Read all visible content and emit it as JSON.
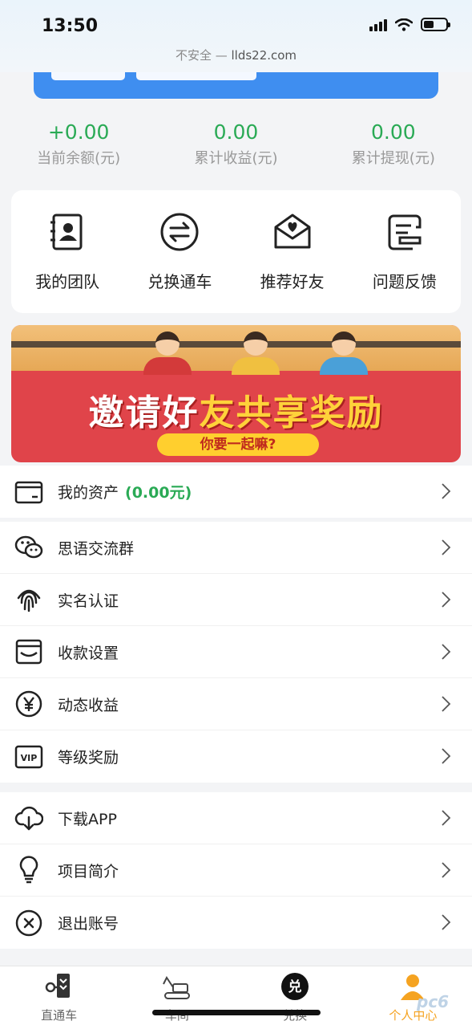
{
  "status": {
    "time": "13:50"
  },
  "browser": {
    "security": "不安全 — ",
    "domain": "llds22.com"
  },
  "stats": [
    {
      "value": "+0.00",
      "label": "当前余额(元)"
    },
    {
      "value": "0.00",
      "label": "累计收益(元)"
    },
    {
      "value": "0.00",
      "label": "累计提现(元)"
    }
  ],
  "quick_actions": [
    {
      "label": "我的团队",
      "icon": "contacts-icon"
    },
    {
      "label": "兑换通车",
      "icon": "exchange-icon"
    },
    {
      "label": "推荐好友",
      "icon": "heart-envelope-icon"
    },
    {
      "label": "问题反馈",
      "icon": "feedback-icon"
    }
  ],
  "promo": {
    "title_white": "邀请好",
    "title_yellow": "友共享奖励",
    "subtitle": "你要一起嘛?"
  },
  "menu_group1": [
    {
      "label": "我的资产",
      "extra": "(0.00元)",
      "icon": "wallet-icon"
    }
  ],
  "menu_group2": [
    {
      "label": "思语交流群",
      "icon": "wechat-icon"
    },
    {
      "label": "实名认证",
      "icon": "fingerprint-icon"
    },
    {
      "label": "收款设置",
      "icon": "inbox-icon"
    },
    {
      "label": "动态收益",
      "icon": "yen-icon"
    },
    {
      "label": "等级奖励",
      "icon": "vip-icon"
    }
  ],
  "menu_group3": [
    {
      "label": "下载APP",
      "icon": "cloud-download-icon"
    },
    {
      "label": "项目简介",
      "icon": "lightbulb-icon"
    },
    {
      "label": "退出账号",
      "icon": "close-circle-icon"
    }
  ],
  "tabs": [
    {
      "label": "直通车",
      "icon": "direct-train-icon",
      "active": false
    },
    {
      "label": "车间",
      "icon": "excavator-icon",
      "active": false
    },
    {
      "label": "兑换",
      "icon": "exchange-badge-icon",
      "active": false
    },
    {
      "label": "个人中心",
      "icon": "user-icon",
      "active": true
    }
  ],
  "colors": {
    "accent_green": "#2aaa55",
    "tab_active": "#f5a321",
    "promo_red": "#e0444a",
    "top_card_blue": "#3f8ef0"
  }
}
